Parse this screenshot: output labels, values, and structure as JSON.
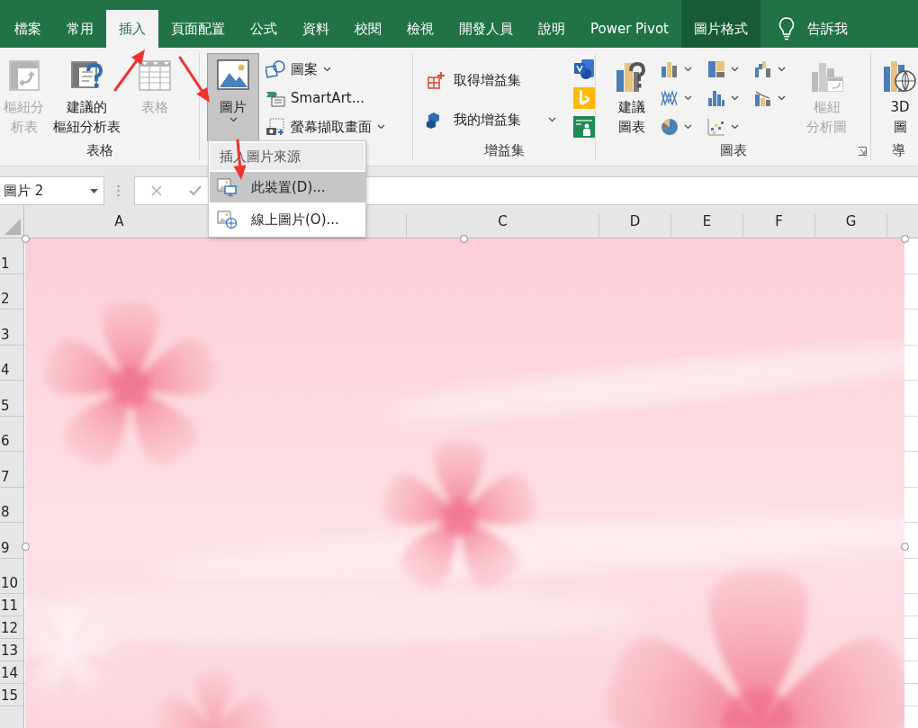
{
  "tabs": [
    {
      "label": "檔案",
      "selected": false,
      "kind": "plain"
    },
    {
      "label": "常用",
      "selected": false,
      "kind": "plain"
    },
    {
      "label": "插入",
      "selected": true,
      "kind": "plain"
    },
    {
      "label": "頁面配置",
      "selected": false,
      "kind": "plain"
    },
    {
      "label": "公式",
      "selected": false,
      "kind": "plain"
    },
    {
      "label": "資料",
      "selected": false,
      "kind": "plain"
    },
    {
      "label": "校閱",
      "selected": false,
      "kind": "plain"
    },
    {
      "label": "檢視",
      "selected": false,
      "kind": "plain"
    },
    {
      "label": "開發人員",
      "selected": false,
      "kind": "plain"
    },
    {
      "label": "說明",
      "selected": false,
      "kind": "plain"
    },
    {
      "label": "Power Pivot",
      "selected": false,
      "kind": "plain"
    },
    {
      "label": "圖片格式",
      "selected": false,
      "kind": "contextual"
    }
  ],
  "tell_me": "告訴我",
  "ribbon": {
    "groups": [
      {
        "label": "表格",
        "items": [
          {
            "lines": [
              "樞紐分",
              "析表"
            ],
            "disabled": true,
            "dropdown": true
          },
          {
            "lines": [
              "建議的",
              "樞紐分析表"
            ],
            "disabled": false,
            "dropdown": false
          },
          {
            "lines": [
              "表格"
            ],
            "disabled": true,
            "dropdown": false
          }
        ]
      },
      {
        "items": [
          {
            "kind": "large",
            "lines": [
              "圖片"
            ],
            "pressed": true,
            "dropdown": true
          },
          {
            "kind": "small",
            "label": "圖案",
            "dropdown": true
          },
          {
            "kind": "small",
            "label": "SmartArt...",
            "dropdown": false
          },
          {
            "kind": "small",
            "label": "螢幕擷取畫面",
            "dropdown": true
          }
        ]
      },
      {
        "label": "增益集",
        "items": [
          {
            "label": "取得增益集",
            "dropdown": false
          },
          {
            "label": "我的增益集",
            "dropdown": true
          }
        ]
      },
      {
        "label": "圖表",
        "items": [
          {
            "lines": [
              "建議",
              "圖表"
            ],
            "disabled": false,
            "dropdown": false
          },
          {
            "lines": [
              "樞紐",
              "分析圖"
            ],
            "disabled": true,
            "dropdown": true
          }
        ]
      },
      {
        "label": "導",
        "items": [
          {
            "lines": [
              "3D",
              "圖"
            ],
            "disabled": false,
            "dropdown": false
          }
        ]
      }
    ]
  },
  "name_box": "圖片 2",
  "columns": [
    "A",
    "C",
    "D",
    "E",
    "F",
    "G"
  ],
  "rows": [
    "1",
    "2",
    "3",
    "4",
    "5",
    "6",
    "7",
    "8",
    "9",
    "10",
    "11",
    "12",
    "13",
    "14",
    "15"
  ],
  "menu": {
    "title": "插入圖片來源",
    "items": [
      {
        "label": "此裝置(D)...",
        "selected": true
      },
      {
        "label": "線上圖片(O)...",
        "selected": false
      }
    ]
  }
}
